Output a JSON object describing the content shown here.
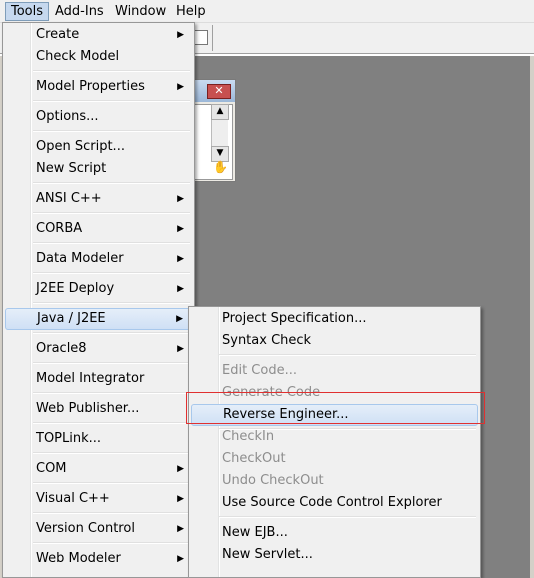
{
  "menubar": {
    "tools": "Tools",
    "addins": "Add-Ins",
    "window": "Window",
    "help": "Help"
  },
  "tools_menu": {
    "items": [
      {
        "label": "Create",
        "submenu": true
      },
      {
        "label": "Check Model",
        "submenu": false
      },
      {
        "label": "Model Properties",
        "submenu": true
      },
      {
        "label": "Options...",
        "submenu": false
      },
      {
        "label": "Open Script...",
        "submenu": false
      },
      {
        "label": "New Script",
        "submenu": false
      },
      {
        "label": "ANSI C++",
        "submenu": true
      },
      {
        "label": "CORBA",
        "submenu": true
      },
      {
        "label": "Data Modeler",
        "submenu": true
      },
      {
        "label": "J2EE Deploy",
        "submenu": true
      },
      {
        "label": "Java / J2EE",
        "submenu": true
      },
      {
        "label": "Oracle8",
        "submenu": true
      },
      {
        "label": "Model Integrator",
        "submenu": false
      },
      {
        "label": "Web Publisher...",
        "submenu": false
      },
      {
        "label": "TOPLink...",
        "submenu": false
      },
      {
        "label": "COM",
        "submenu": true
      },
      {
        "label": "Visual C++",
        "submenu": true
      },
      {
        "label": "Version Control",
        "submenu": true
      },
      {
        "label": "Web Modeler",
        "submenu": true
      }
    ],
    "highlighted": "Java / J2EE"
  },
  "java_submenu": {
    "items": [
      {
        "label": "Project Specification...",
        "enabled": true
      },
      {
        "label": "Syntax Check",
        "enabled": true
      },
      {
        "label": "Edit Code...",
        "enabled": false
      },
      {
        "label": "Generate Code",
        "enabled": false
      },
      {
        "label": "Reverse Engineer...",
        "enabled": true
      },
      {
        "label": "CheckIn",
        "enabled": false
      },
      {
        "label": "CheckOut",
        "enabled": false
      },
      {
        "label": "Undo CheckOut",
        "enabled": false
      },
      {
        "label": "Use Source Code Control Explorer",
        "enabled": true
      },
      {
        "label": "New EJB...",
        "enabled": true
      },
      {
        "label": "New Servlet...",
        "enabled": true
      }
    ],
    "highlighted": "Reverse Engineer..."
  },
  "icons": {
    "submenu_arrow": "chevron-right-icon",
    "close": "close-icon",
    "hand": "hand-pointer-icon"
  },
  "colors": {
    "highlight_border": "#a8c8ec",
    "callout_border": "#e03030"
  }
}
